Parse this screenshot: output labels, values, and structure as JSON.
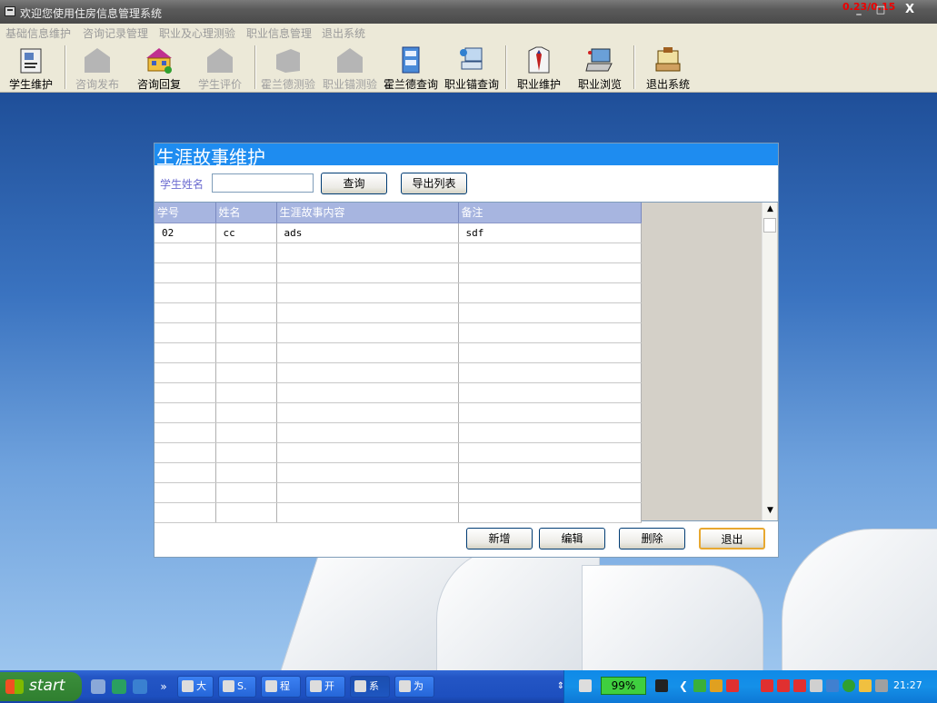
{
  "window": {
    "title": "欢迎您使用住房信息管理系统",
    "overlay_text": "0.23/0.15",
    "minimize": "_",
    "maximize": "□",
    "close": "X"
  },
  "menu": [
    "基础信息维护",
    "咨询记录管理",
    "职业及心理测验",
    "职业信息管理",
    "退出系统"
  ],
  "toolbar": [
    {
      "label": "学生维护",
      "enabled": true,
      "icon": "student-card-icon"
    },
    {
      "label": "咨询发布",
      "enabled": false,
      "icon": "house-icon"
    },
    {
      "label": "咨询回复",
      "enabled": true,
      "icon": "colorful-house-icon"
    },
    {
      "label": "学生评价",
      "enabled": false,
      "icon": "house-icon"
    },
    {
      "label": "霍兰德测验",
      "enabled": false,
      "icon": "building-icon"
    },
    {
      "label": "职业锚测验",
      "enabled": false,
      "icon": "house-icon"
    },
    {
      "label": "霍兰德查询",
      "enabled": true,
      "icon": "cabinet-icon"
    },
    {
      "label": "职业锚查询",
      "enabled": true,
      "icon": "network-computer-icon"
    },
    {
      "label": "职业维护",
      "enabled": true,
      "icon": "shirt-tie-icon"
    },
    {
      "label": "职业浏览",
      "enabled": true,
      "icon": "laptop-icon"
    },
    {
      "label": "退出系统",
      "enabled": true,
      "icon": "exit-desk-icon"
    }
  ],
  "dialog": {
    "title": "生涯故事维护",
    "search_label": "学生姓名",
    "search_value": "",
    "query_button": "查询",
    "export_button": "导出列表",
    "columns": [
      "学号",
      "姓名",
      "生涯故事内容",
      "备注"
    ],
    "rows": [
      [
        "02",
        "cc",
        "ads",
        "sdf"
      ],
      [
        "",
        "",
        "",
        ""
      ],
      [
        "",
        "",
        "",
        ""
      ],
      [
        "",
        "",
        "",
        ""
      ],
      [
        "",
        "",
        "",
        ""
      ],
      [
        "",
        "",
        "",
        ""
      ],
      [
        "",
        "",
        "",
        ""
      ],
      [
        "",
        "",
        "",
        ""
      ],
      [
        "",
        "",
        "",
        ""
      ],
      [
        "",
        "",
        "",
        ""
      ],
      [
        "",
        "",
        "",
        ""
      ],
      [
        "",
        "",
        "",
        ""
      ],
      [
        "",
        "",
        "",
        ""
      ],
      [
        "",
        "",
        "",
        ""
      ],
      [
        "",
        "",
        "",
        ""
      ]
    ],
    "buttons": {
      "add": "新增",
      "edit": "编辑",
      "delete": "删除",
      "exit": "退出"
    }
  },
  "taskbar": {
    "start_label": "start",
    "tasks": [
      "大",
      "S.",
      "程",
      "开",
      "系",
      "为"
    ],
    "battery": "99%",
    "clock": "21:27"
  }
}
